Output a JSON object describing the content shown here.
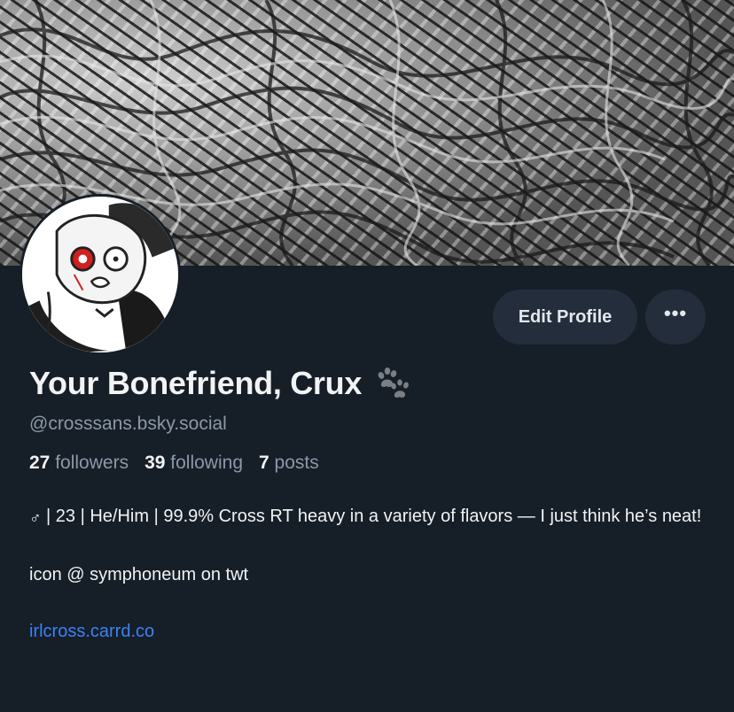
{
  "profile": {
    "display_name": "Your Bonefriend, Crux",
    "handle": "@crosssans.bsky.social",
    "stats": [
      {
        "count": "27",
        "label": "followers"
      },
      {
        "count": "39",
        "label": "following"
      },
      {
        "count": "7",
        "label": "posts"
      }
    ],
    "bio": {
      "line1_symbol": "♂",
      "line1_text": " | 23 | He/Him | 99.9% Cross RT heavy in a variety of flavors — I just think he’s neat!",
      "line2": "icon @ symphoneum on twt",
      "link": "irlcross.carrd.co"
    }
  },
  "actions": {
    "edit_profile": "Edit Profile",
    "more": "•••"
  },
  "icons": {
    "name_badge": "paw-print-icon",
    "more": "ellipsis-icon"
  },
  "colors": {
    "background": "#161e27",
    "button_bg": "#232d3c",
    "muted_text": "#8c98a8",
    "link": "#3b83f6",
    "avatar_eye": "#d11f1f"
  }
}
